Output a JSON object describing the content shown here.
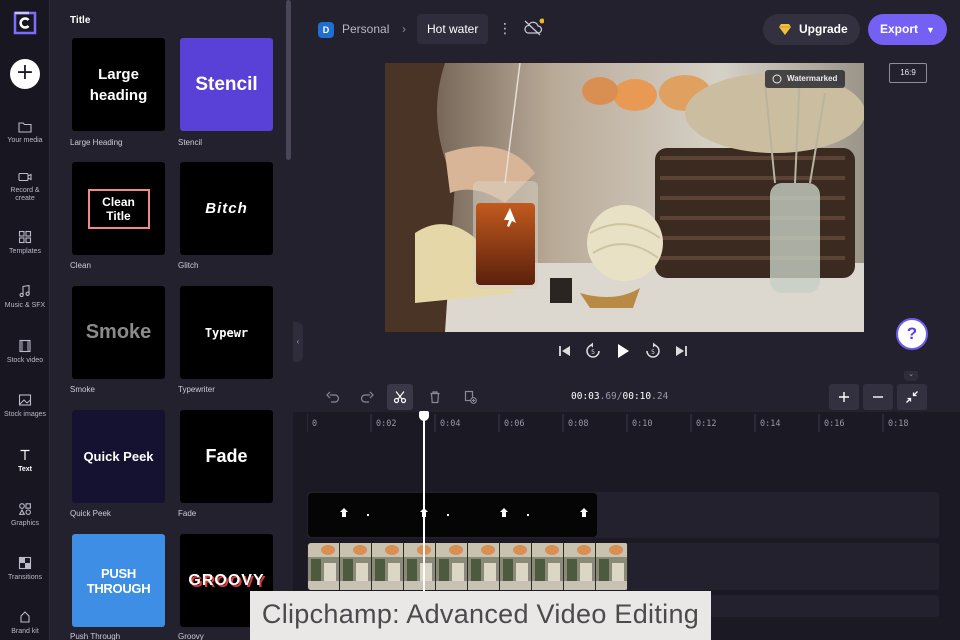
{
  "header": {
    "workspace_initial": "D",
    "workspace_name": "Personal",
    "project_name": "Hot water",
    "upgrade_label": "Upgrade",
    "export_label": "Export",
    "aspect_ratio": "16:9"
  },
  "rail": {
    "items": [
      {
        "label": "Your media",
        "icon": "folder-icon"
      },
      {
        "label": "Record & create",
        "icon": "camera-icon"
      },
      {
        "label": "Templates",
        "icon": "templates-icon"
      },
      {
        "label": "Music & SFX",
        "icon": "music-icon"
      },
      {
        "label": "Stock video",
        "icon": "film-icon"
      },
      {
        "label": "Stock images",
        "icon": "image-icon"
      },
      {
        "label": "Text",
        "icon": "text-icon"
      },
      {
        "label": "Graphics",
        "icon": "shapes-icon"
      },
      {
        "label": "Transitions",
        "icon": "transitions-icon"
      },
      {
        "label": "Brand kit",
        "icon": "brand-icon"
      }
    ],
    "active_index": 6
  },
  "panel": {
    "title": "Title",
    "cards": [
      {
        "label": "Large Heading",
        "preview": "Large heading"
      },
      {
        "label": "Stencil",
        "preview": "Stencil"
      },
      {
        "label": "Clean",
        "preview": "Clean Title"
      },
      {
        "label": "Glitch",
        "preview": "Bitch"
      },
      {
        "label": "Smoke",
        "preview": "Smoke"
      },
      {
        "label": "Typewriter",
        "preview": "Typewr"
      },
      {
        "label": "Quick Peek",
        "preview": "Quick Peek"
      },
      {
        "label": "Fade",
        "preview": "Fade"
      },
      {
        "label": "Push Through",
        "preview": "PUSH THROUGH"
      },
      {
        "label": "Groovy",
        "preview": "GROOVY"
      }
    ]
  },
  "preview": {
    "watermark_label": "Watermarked",
    "help_label": "?"
  },
  "timeline": {
    "current_time_main": "00:03",
    "current_time_frac": ".69",
    "separator": "/",
    "total_time_main": "00:10",
    "total_time_frac": ".24",
    "ruler": [
      "0",
      "0:02",
      "0:04",
      "0:06",
      "0:08",
      "0:10",
      "0:12",
      "0:14",
      "0:16",
      "0:18"
    ],
    "playhead_seconds": 3.69
  },
  "caption": "Clipchamp: Advanced Video Editing",
  "colors": {
    "accent": "#7460f2",
    "background": "#24212f",
    "rail": "#181620"
  }
}
